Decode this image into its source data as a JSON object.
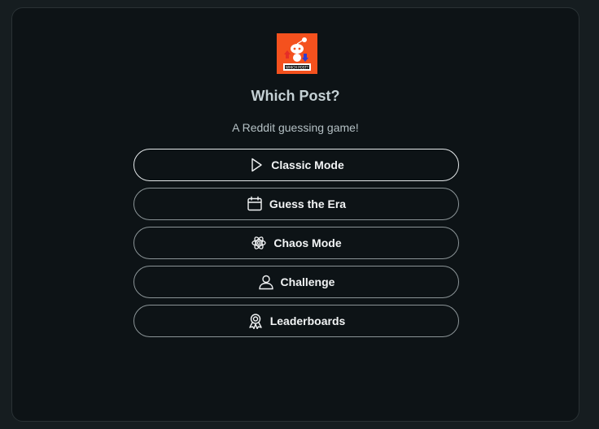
{
  "app": {
    "logo": "which-post-logo",
    "logo_text": "WHICH POST?",
    "title": "Which Post?",
    "subtitle": "A Reddit guessing game!"
  },
  "menu": [
    {
      "label": "Classic Mode",
      "icon": "play-icon"
    },
    {
      "label": "Guess the Era",
      "icon": "calendar-icon"
    },
    {
      "label": "Chaos Mode",
      "icon": "atom-icon"
    },
    {
      "label": "Challenge",
      "icon": "user-icon"
    },
    {
      "label": "Leaderboards",
      "icon": "award-icon"
    }
  ],
  "colors": {
    "background": "#161d20",
    "card": "#0d1316",
    "brand": "#f4511e",
    "text": "#f2f4f5"
  }
}
